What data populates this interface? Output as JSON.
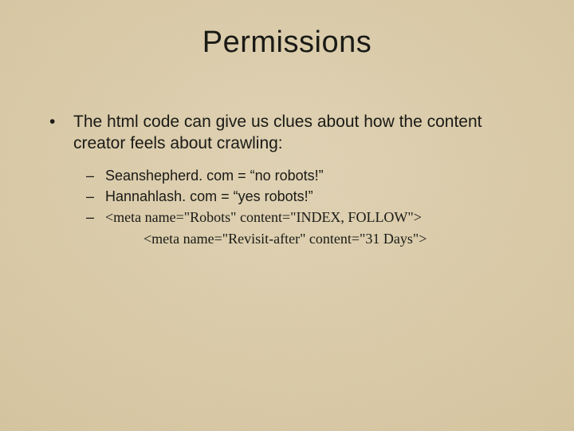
{
  "title": "Permissions",
  "main_bullet": "The html code can give us clues about how the content creator feels about crawling:",
  "sub": {
    "item1": "Seanshepherd. com = “no robots!”",
    "item2": "Hannahlash. com = “yes robots!”",
    "item3": "<meta name=\"Robots\" content=\"INDEX, FOLLOW\">",
    "item3b": "<meta name=\"Revisit-after\" content=\"31 Days\">"
  },
  "glyphs": {
    "bullet": "•",
    "dash": "–"
  }
}
